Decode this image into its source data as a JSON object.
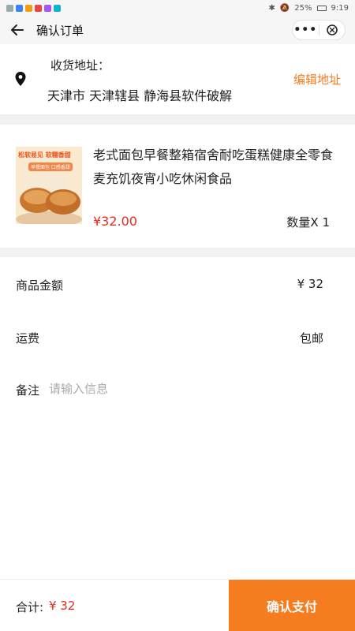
{
  "status_bar": {
    "battery": "25%",
    "time": "9:19"
  },
  "nav": {
    "title": "确认订单",
    "more_label": "•••"
  },
  "address": {
    "label": "收货地址：",
    "text": "天津市 天津辖县 静海县软件破解",
    "edit_label": "编辑地址"
  },
  "product": {
    "thumb_text": "松软易见  软糯香甜",
    "thumb_badge": "早餐面包 口感香甜",
    "title": "老式面包早餐整箱宿舍耐吃蛋糕健康全零食麦充饥夜宵小吃休闲食品",
    "price": "¥32.00",
    "quantity": "数量X 1"
  },
  "summary": {
    "amount_label": "商品金额",
    "amount_value": "¥ 32",
    "shipping_label": "运费",
    "shipping_value": "包邮",
    "remark_label": "备注",
    "remark_placeholder": "请输入信息",
    "remark_value": ""
  },
  "footer": {
    "total_label": "合计:",
    "total_value": "¥ 32",
    "pay_label": "确认支付"
  },
  "colors": {
    "accent": "#f57c1f",
    "price": "#e02e24",
    "background": "#f1f1f1"
  }
}
